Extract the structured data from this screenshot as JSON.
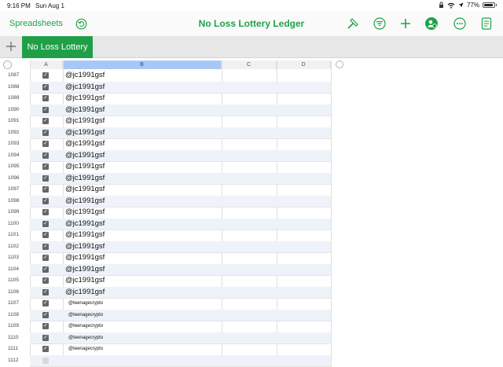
{
  "status": {
    "time": "9:16 PM",
    "date": "Sun Aug 1",
    "battery": "77%",
    "battery_level": 0.77
  },
  "toolbar": {
    "back_label": "Spreadsheets",
    "title": "No Loss Lottery Ledger",
    "icons": [
      "undo-icon",
      "hammer-icon",
      "filter-icon",
      "plus-icon",
      "collaborate-icon",
      "more-icon",
      "view-icon"
    ]
  },
  "tabs": {
    "sheet_tab": "No Loss Lottery"
  },
  "columns": [
    "A",
    "B",
    "C",
    "D"
  ],
  "rows": [
    {
      "num": "1087",
      "checked": true,
      "value": "@jc1991gsf"
    },
    {
      "num": "1088",
      "checked": true,
      "value": "@jc1991gsf"
    },
    {
      "num": "1089",
      "checked": true,
      "value": "@jc1991gsf"
    },
    {
      "num": "1090",
      "checked": true,
      "value": "@jc1991gsf"
    },
    {
      "num": "1091",
      "checked": true,
      "value": "@jc1991gsf"
    },
    {
      "num": "1092",
      "checked": true,
      "value": "@jc1991gsf"
    },
    {
      "num": "1093",
      "checked": true,
      "value": "@jc1991gsf"
    },
    {
      "num": "1094",
      "checked": true,
      "value": "@jc1991gsf"
    },
    {
      "num": "1095",
      "checked": true,
      "value": "@jc1991gsf"
    },
    {
      "num": "1096",
      "checked": true,
      "value": "@jc1991gsf"
    },
    {
      "num": "1097",
      "checked": true,
      "value": "@jc1991gsf"
    },
    {
      "num": "1098",
      "checked": true,
      "value": "@jc1991gsf"
    },
    {
      "num": "1099",
      "checked": true,
      "value": "@jc1991gsf"
    },
    {
      "num": "1100",
      "checked": true,
      "value": "@jc1991gsf"
    },
    {
      "num": "1101",
      "checked": true,
      "value": "@jc1991gsf"
    },
    {
      "num": "1102",
      "checked": true,
      "value": "@jc1991gsf"
    },
    {
      "num": "1103",
      "checked": true,
      "value": "@jc1991gsf"
    },
    {
      "num": "1104",
      "checked": true,
      "value": "@jc1991gsf"
    },
    {
      "num": "1105",
      "checked": true,
      "value": "@jc1991gsf"
    },
    {
      "num": "1106",
      "checked": true,
      "value": "@jc1991gsf"
    },
    {
      "num": "1107",
      "checked": true,
      "value": "@teenagecrypto"
    },
    {
      "num": "1108",
      "checked": true,
      "value": "@teenagecrypto"
    },
    {
      "num": "1109",
      "checked": true,
      "value": "@teenagecrypto"
    },
    {
      "num": "1110",
      "checked": true,
      "value": "@teenagecrypto"
    },
    {
      "num": "1111",
      "checked": true,
      "value": "@teenagecrypto"
    },
    {
      "num": "1112",
      "checked": false,
      "value": ""
    }
  ],
  "colors": {
    "accent": "#1ea34a",
    "selected_column": "#a7c7f7"
  }
}
